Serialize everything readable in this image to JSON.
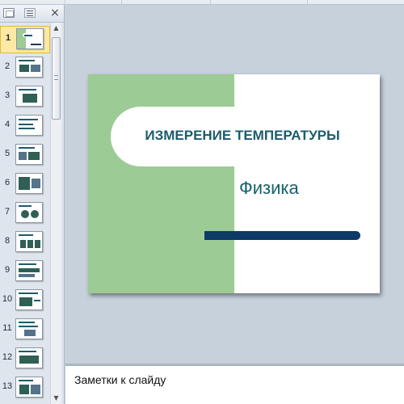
{
  "window": {
    "pane_close_glyph": "×",
    "scroll_up_glyph": "▲",
    "scroll_down_glyph": "▼"
  },
  "slides_pane": {
    "thumbnails": [
      {
        "number": "1",
        "selected": true
      },
      {
        "number": "2"
      },
      {
        "number": "3"
      },
      {
        "number": "4"
      },
      {
        "number": "5"
      },
      {
        "number": "6"
      },
      {
        "number": "7"
      },
      {
        "number": "8"
      },
      {
        "number": "9"
      },
      {
        "number": "10"
      },
      {
        "number": "11"
      },
      {
        "number": "12"
      },
      {
        "number": "13"
      }
    ]
  },
  "slide": {
    "title": "ИЗМЕРЕНИЕ ТЕМПЕРАТУРЫ",
    "subtitle": "Физика"
  },
  "notes": {
    "placeholder": "Заметки к слайду"
  },
  "colors": {
    "green_panel": "#9ccb95",
    "title_text": "#1a5c6e",
    "accent_bar": "#0d3a66",
    "selection": "#fde9a3"
  }
}
